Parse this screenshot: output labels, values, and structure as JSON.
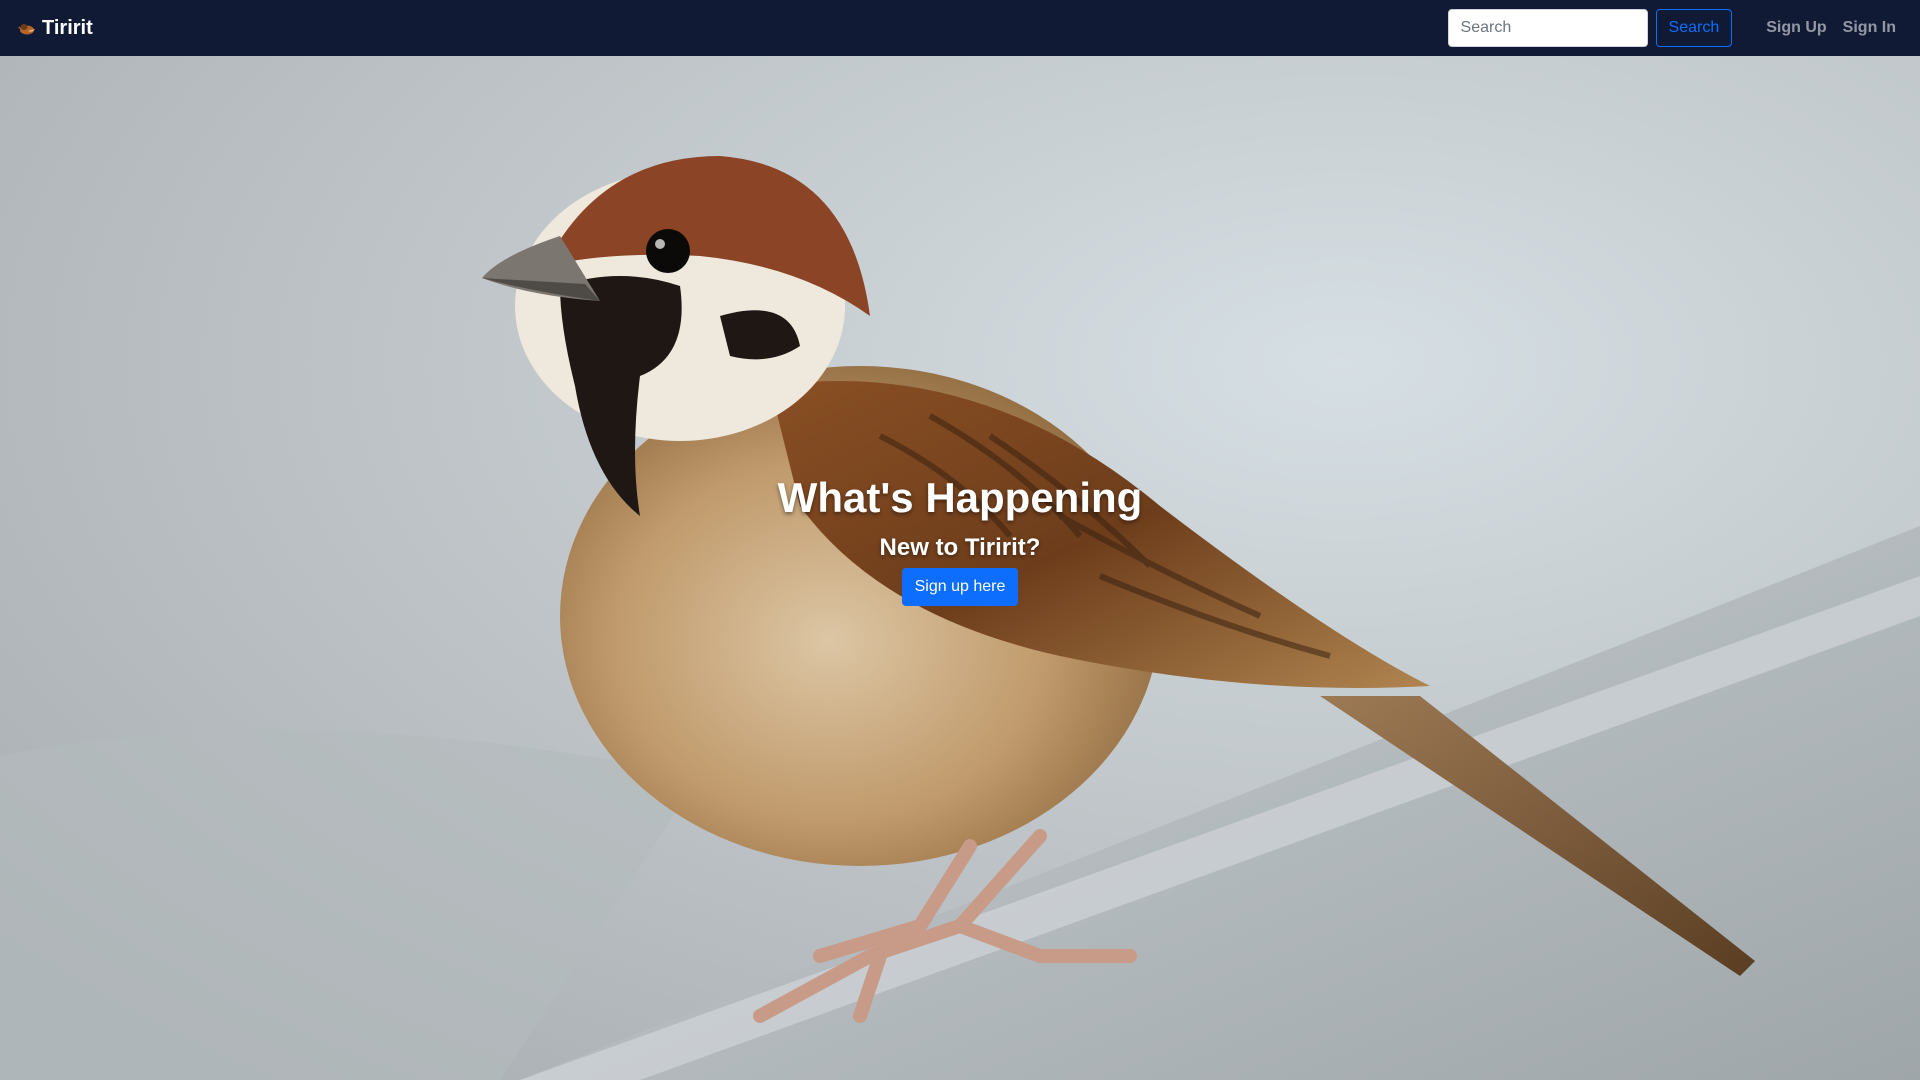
{
  "navbar": {
    "brand": "Tiririt",
    "brand_icon": "bird-logo-icon",
    "search": {
      "placeholder": "Search",
      "value": "",
      "button_label": "Search"
    },
    "links": [
      {
        "label": "Sign Up"
      },
      {
        "label": "Sign In"
      }
    ]
  },
  "hero": {
    "title": "What's Happening",
    "subtitle": "New to Tiririt?",
    "cta_label": "Sign up here",
    "background_image": "sparrow-photo"
  },
  "colors": {
    "navbar_bg": "#111a35",
    "primary": "#0d6efd",
    "nav_link": "rgba(255,255,255,0.55)"
  }
}
